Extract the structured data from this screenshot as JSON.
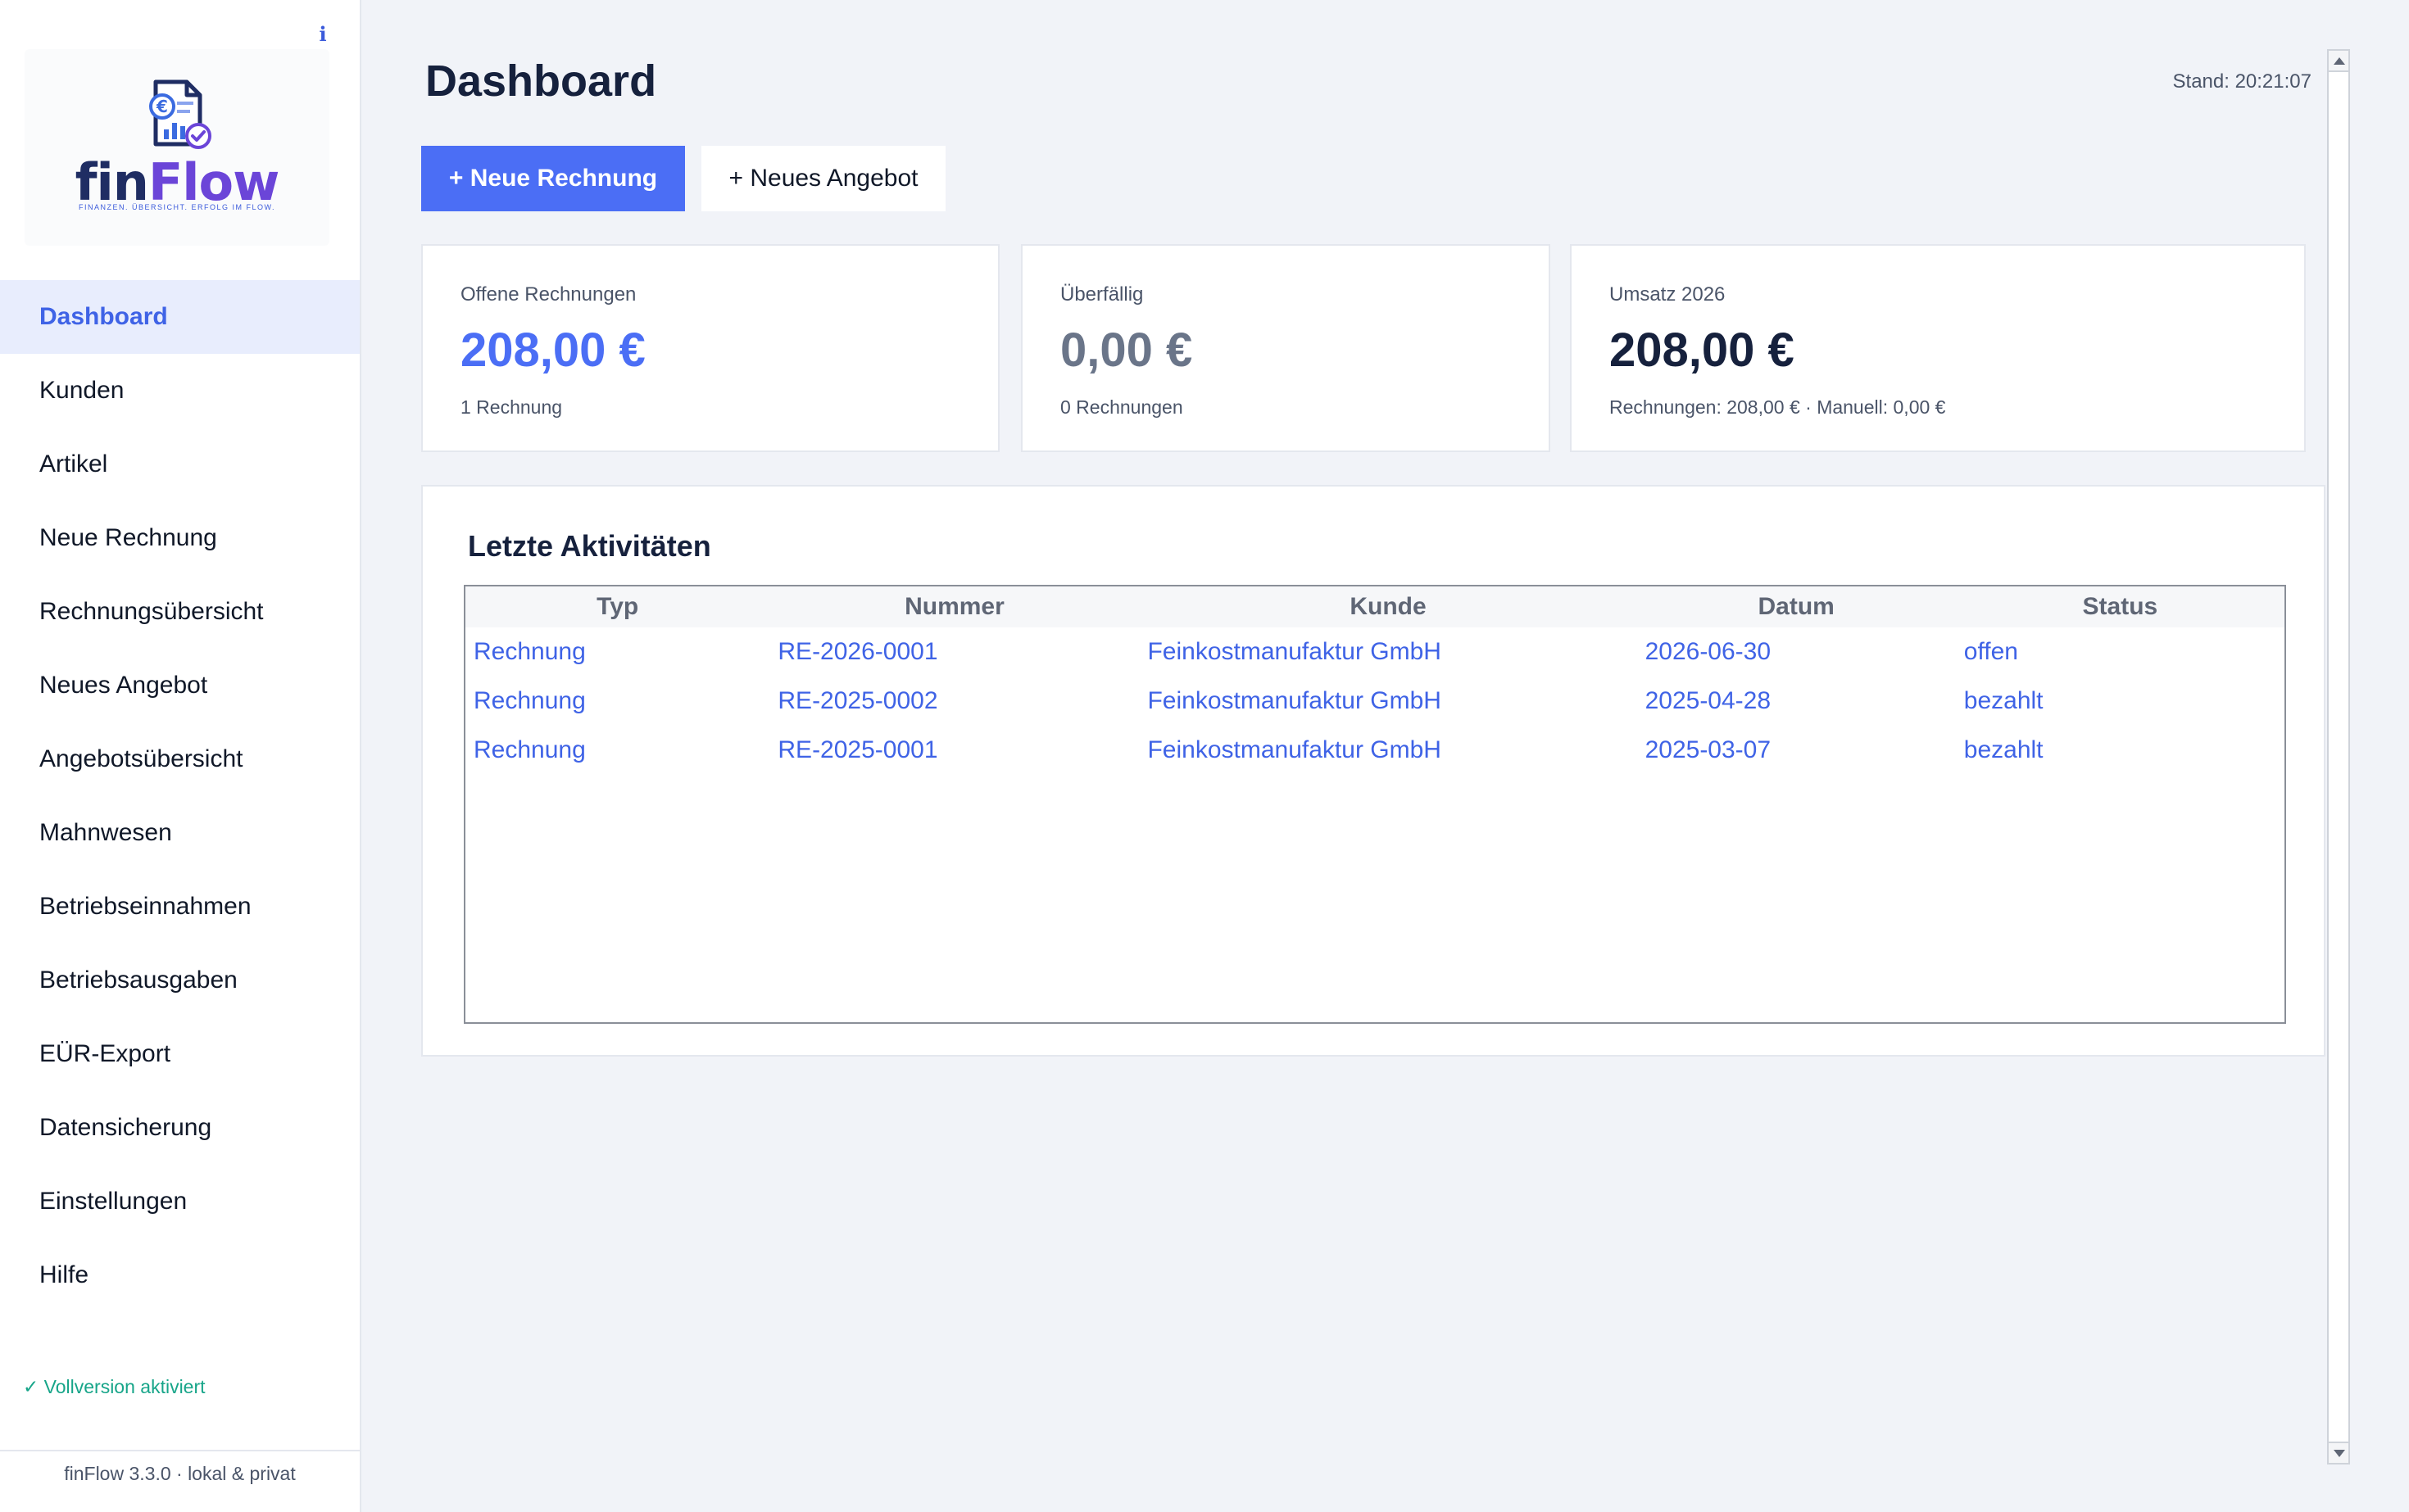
{
  "sidebar": {
    "info_icon": "i",
    "logo": {
      "word_fin": "fin",
      "word_flow": "Flow",
      "tagline": "FINANZEN. ÜBERSICHT. ERFOLG IM FLOW."
    },
    "items": [
      {
        "label": "Dashboard",
        "active": true
      },
      {
        "label": "Kunden"
      },
      {
        "label": "Artikel"
      },
      {
        "label": "Neue Rechnung"
      },
      {
        "label": "Rechnungsübersicht"
      },
      {
        "label": "Neues Angebot"
      },
      {
        "label": "Angebotsübersicht"
      },
      {
        "label": "Mahnwesen"
      },
      {
        "label": "Betriebseinnahmen"
      },
      {
        "label": "Betriebsausgaben"
      },
      {
        "label": "EÜR-Export"
      },
      {
        "label": "Datensicherung"
      },
      {
        "label": "Einstellungen"
      },
      {
        "label": "Hilfe"
      }
    ],
    "license_text": "✓  Vollversion aktiviert",
    "footer": "finFlow 3.3.0 · lokal & privat"
  },
  "header": {
    "title": "Dashboard",
    "stand": "Stand: 20:21:07"
  },
  "actions": {
    "new_invoice": "+ Neue Rechnung",
    "new_offer": "+ Neues Angebot"
  },
  "cards": [
    {
      "label": "Offene Rechnungen",
      "value": "208,00 €",
      "sub": "1 Rechnung"
    },
    {
      "label": "Überfällig",
      "value": "0,00 €",
      "sub": "0 Rechnungen"
    },
    {
      "label": "Umsatz 2026",
      "value": "208,00 €",
      "sub": "Rechnungen: 208,00 €  ·  Manuell: 0,00 €"
    }
  ],
  "activities": {
    "title": "Letzte Aktivitäten",
    "columns": [
      "Typ",
      "Nummer",
      "Kunde",
      "Datum",
      "Status"
    ],
    "rows": [
      [
        "Rechnung",
        "RE-2026-0001",
        "Feinkostmanufaktur GmbH",
        "2026-06-30",
        "offen"
      ],
      [
        "Rechnung",
        "RE-2025-0002",
        "Feinkostmanufaktur GmbH",
        "2025-04-28",
        "bezahlt"
      ],
      [
        "Rechnung",
        "RE-2025-0001",
        "Feinkostmanufaktur GmbH",
        "2025-03-07",
        "bezahlt"
      ]
    ]
  },
  "colors": {
    "accent": "#4b6ef5",
    "link": "#3f63e6",
    "dark": "#16213d",
    "success": "#17a589"
  }
}
